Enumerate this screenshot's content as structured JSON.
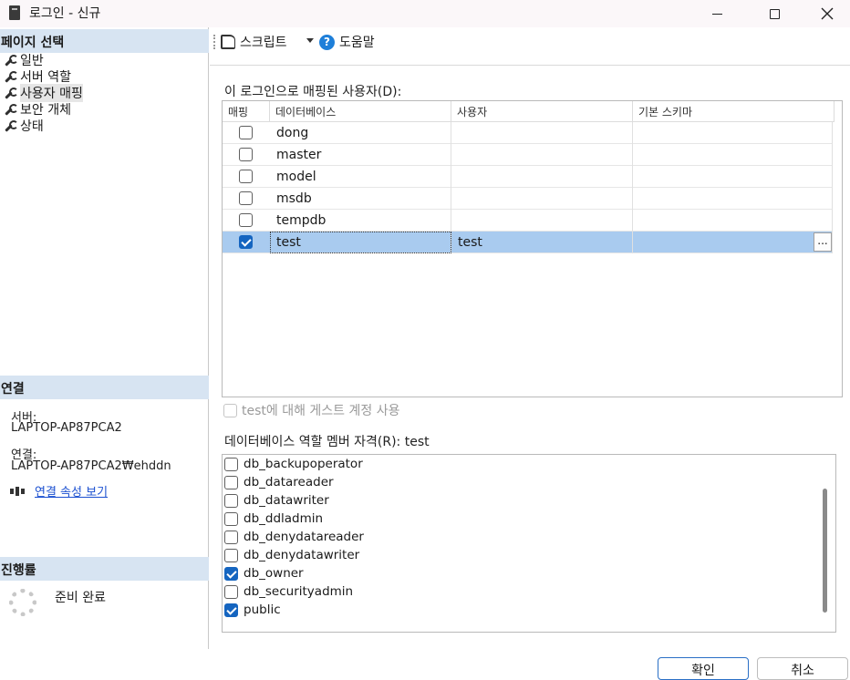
{
  "window": {
    "title": "로그인 - 신규"
  },
  "left": {
    "page_select_header": "페이지 선택",
    "pages": [
      {
        "label": "일반"
      },
      {
        "label": "서버 역할"
      },
      {
        "label": "사용자 매핑"
      },
      {
        "label": "보안 개체"
      },
      {
        "label": "상태"
      }
    ],
    "connection_header": "연결",
    "server_label": "서버:",
    "server_value": "LAPTOP-AP87PCA2",
    "connection_label": "연결:",
    "connection_value": "LAPTOP-AP87PCA2₩ehddn",
    "view_conn_props": "연결 속성 보기",
    "progress_header": "진행률",
    "progress_status": "준비 완료"
  },
  "toolbar": {
    "script_label": "스크립트",
    "help_label": "도움말"
  },
  "mapping": {
    "section_label": "이 로그인으로 매핑된 사용자(D):",
    "columns": [
      "매핑",
      "데이터베이스",
      "사용자",
      "기본 스키마"
    ],
    "rows": [
      {
        "mapped": false,
        "database": "dong",
        "user": "",
        "schema": ""
      },
      {
        "mapped": false,
        "database": "master",
        "user": "",
        "schema": ""
      },
      {
        "mapped": false,
        "database": "model",
        "user": "",
        "schema": ""
      },
      {
        "mapped": false,
        "database": "msdb",
        "user": "",
        "schema": ""
      },
      {
        "mapped": false,
        "database": "tempdb",
        "user": "",
        "schema": ""
      },
      {
        "mapped": true,
        "database": "test",
        "user": "test",
        "schema": "",
        "ellipsis": "..."
      }
    ]
  },
  "guest": {
    "label": "test에 대해 게스트 계정 사용"
  },
  "roles": {
    "section_label": "데이터베이스 역할 멤버 자격(R): test",
    "items": [
      {
        "name": "db_backupoperator",
        "checked": false
      },
      {
        "name": "db_datareader",
        "checked": false
      },
      {
        "name": "db_datawriter",
        "checked": false
      },
      {
        "name": "db_ddladmin",
        "checked": false
      },
      {
        "name": "db_denydatareader",
        "checked": false
      },
      {
        "name": "db_denydatawriter",
        "checked": false
      },
      {
        "name": "db_owner",
        "checked": true
      },
      {
        "name": "db_securityadmin",
        "checked": false
      },
      {
        "name": "public",
        "checked": true
      }
    ]
  },
  "buttons": {
    "ok": "확인",
    "cancel": "취소"
  },
  "colors": {
    "selection": "#a9cbef",
    "section_header": "#d7e4f2",
    "checkbox_on": "#1565c0",
    "link": "#1a4fd0"
  }
}
